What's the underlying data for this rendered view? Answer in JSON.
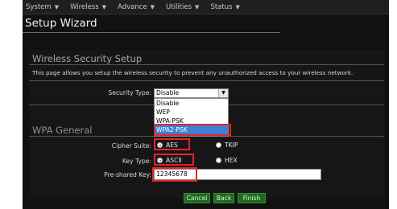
{
  "nav": {
    "items": [
      {
        "label": "System"
      },
      {
        "label": "Wireless"
      },
      {
        "label": "Advance"
      },
      {
        "label": "Utilities"
      },
      {
        "label": "Status"
      }
    ]
  },
  "page": {
    "title": "Setup Wizard"
  },
  "security": {
    "title": "Wireless Security Setup",
    "description": "This page allows you setup the wireless security to prevent any unauthorized access to your wireless network.",
    "type_label": "Security Type:",
    "type_value": "Disable",
    "options": [
      "Disable",
      "WEP",
      "WPA-PSK",
      "WPA2-PSK"
    ],
    "selected_option": "WPA2-PSK"
  },
  "wpa": {
    "title": "WPA General",
    "cipher_label": "Cipher Suite:",
    "cipher_options": [
      "AES",
      "TKIP"
    ],
    "cipher_selected": "AES",
    "key_type_label": "Key Type:",
    "key_type_options": [
      "ASCII",
      "HEX"
    ],
    "key_type_selected": "ASCII",
    "psk_label": "Pre-shared Key:",
    "psk_value": "12345678"
  },
  "buttons": {
    "cancel": "Cancel",
    "back": "Back",
    "finish": "Finish"
  },
  "colors": {
    "highlight": "#e4232a",
    "selected_option": "#3b7fd6",
    "button": "#1d6a1d",
    "background": "#111111"
  }
}
